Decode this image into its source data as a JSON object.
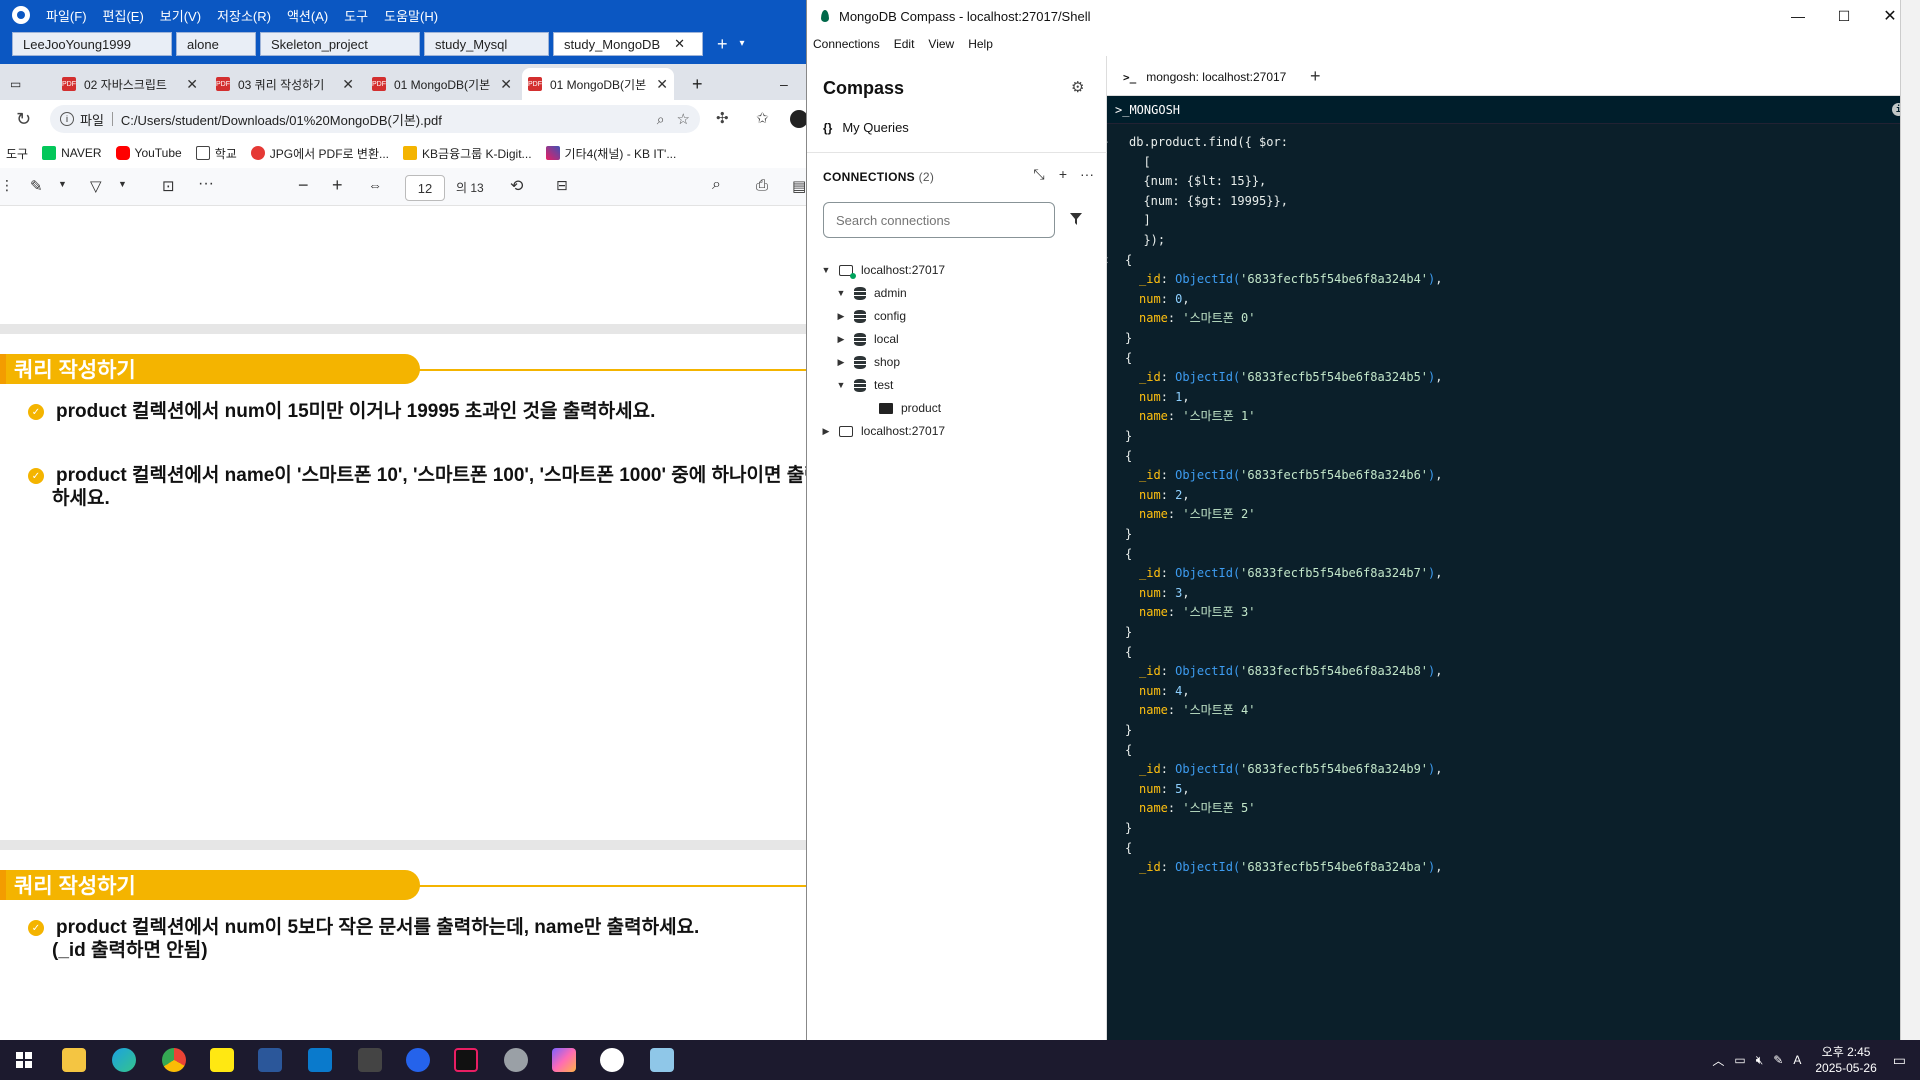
{
  "bgapp": {
    "menu": [
      "파일(F)",
      "편집(E)",
      "보기(V)",
      "저장소(R)",
      "액션(A)",
      "도구",
      "도움말(H)"
    ],
    "tabs": [
      "LeeJooYoung1999",
      "alone",
      "Skeleton_project",
      "study_Mysql",
      "study_MongoDB"
    ],
    "close": "✕",
    "plus": "+",
    "dropdown": "▾"
  },
  "browser": {
    "tabs": [
      "02 자바스크립트",
      "03 쿼리 작성하기",
      "01 MongoDB(기본",
      "01 MongoDB(기본"
    ],
    "url_scheme": "파일",
    "url": "C:/Users/student/Downloads/01%20MongoDB(기본).pdf",
    "bookmarks": [
      "도구",
      "NAVER",
      "YouTube",
      "학교",
      "JPG에서 PDF로 변환...",
      "KB금융그룹 K-Digit...",
      "기타4(채널) - KB IT'..."
    ],
    "page_current": "12",
    "page_total": "의 13",
    "slides": [
      {
        "header": "쿼리 작성하기",
        "items": [
          "product 컬렉션에서 num이 15미만 이거나 19995 초과인 것을 출력하세요.",
          "product 컬렉션에서 name이 '스마트폰 10', '스마트폰 100', '스마트폰 1000' 중에 하나이면 출력",
          "하세요."
        ]
      },
      {
        "header": "쿼리 작성하기",
        "items": [
          "product 컬렉션에서 num이 5보다 작은 문서를 출력하는데, name만 출력하세요.",
          "(_id 출력하면 안됨)"
        ]
      }
    ]
  },
  "compass": {
    "window_title": "MongoDB Compass - localhost:27017/Shell",
    "menu": [
      "Connections",
      "Edit",
      "View",
      "Help"
    ],
    "sidebar": {
      "title": "Compass",
      "my_queries": "My Queries",
      "connections_label": "CONNECTIONS",
      "connections_count": "(2)",
      "search_placeholder": "Search connections",
      "tree": [
        {
          "label": "localhost:27017",
          "level": 0,
          "kind": "connection",
          "expanded": true
        },
        {
          "label": "admin",
          "level": 1,
          "kind": "db",
          "expanded": true
        },
        {
          "label": "config",
          "level": 1,
          "kind": "db",
          "expanded": false
        },
        {
          "label": "local",
          "level": 1,
          "kind": "db",
          "expanded": false
        },
        {
          "label": "shop",
          "level": 1,
          "kind": "db",
          "expanded": false
        },
        {
          "label": "test",
          "level": 1,
          "kind": "db",
          "expanded": true
        },
        {
          "label": "product",
          "level": 2,
          "kind": "collection",
          "expanded": false
        },
        {
          "label": "localhost:27017",
          "level": 0,
          "kind": "connection",
          "expanded": false
        }
      ]
    },
    "shell": {
      "tab_label": "mongosh: localhost:27017",
      "tab_prompt_glyph": ">_",
      "header": ">_MONGOSH",
      "command_lines": [
        "db.product.find({ $or:",
        "  [",
        "  {num: {$lt: 15}},",
        "  {num: {$gt: 19995}},",
        "  ]",
        "  });"
      ],
      "docs": [
        {
          "id": "6833fecfb5f54be6f8a324b4",
          "num": "0",
          "name": "'스마트폰 0'"
        },
        {
          "id": "6833fecfb5f54be6f8a324b5",
          "num": "1",
          "name": "'스마트폰 1'"
        },
        {
          "id": "6833fecfb5f54be6f8a324b6",
          "num": "2",
          "name": "'스마트폰 2'"
        },
        {
          "id": "6833fecfb5f54be6f8a324b7",
          "num": "3",
          "name": "'스마트폰 3'"
        },
        {
          "id": "6833fecfb5f54be6f8a324b8",
          "num": "4",
          "name": "'스마트폰 4'"
        },
        {
          "id": "6833fecfb5f54be6f8a324b9",
          "num": "5",
          "name": "'스마트폰 5'"
        },
        {
          "id": "6833fecfb5f54be6f8a324ba",
          "num": "",
          "name": ""
        }
      ]
    }
  },
  "taskbar": {
    "time": "오후 2:45",
    "date": "2025-05-26",
    "ime": "A"
  },
  "colors": {
    "shell_bg": "#0b1f2a",
    "accent_yellow": "#f4b400",
    "app_blue": "#0b57c2",
    "mongo_green": "#00684a"
  }
}
